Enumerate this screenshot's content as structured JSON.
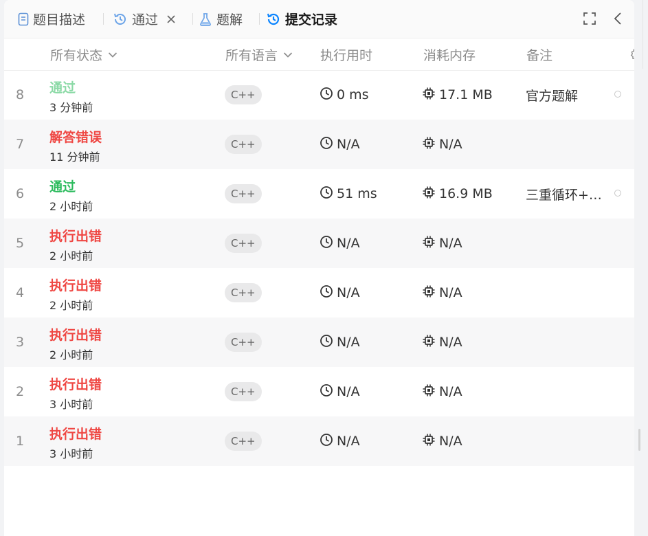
{
  "tabs": {
    "description": {
      "label": "题目描述",
      "icon": "document-icon"
    },
    "result": {
      "label": "通过",
      "icon": "history-icon"
    },
    "solutions": {
      "label": "题解",
      "icon": "flask-icon"
    },
    "submissions": {
      "label": "提交记录",
      "icon": "history-icon"
    }
  },
  "header": {
    "status": "所有状态",
    "language": "所有语言",
    "runtime": "执行用时",
    "memory": "消耗内存",
    "note": "备注"
  },
  "colors": {
    "accepted": "#2cbb5d",
    "error": "#ef4743",
    "active_tab_icon": "#0a84ff"
  },
  "submissions": [
    {
      "index": "8",
      "status": "通过",
      "time": "3 分钟前",
      "lang": "C++",
      "runtime": "0 ms",
      "memory": "17.1 MB",
      "note": "官方题解"
    },
    {
      "index": "7",
      "status": "解答错误",
      "time": "11 分钟前",
      "lang": "C++",
      "runtime": "N/A",
      "memory": "N/A",
      "note": ""
    },
    {
      "index": "6",
      "status": "通过",
      "time": "2 小时前",
      "lang": "C++",
      "runtime": "51 ms",
      "memory": "16.9 MB",
      "note": "三重循环+…"
    },
    {
      "index": "5",
      "status": "执行出错",
      "time": "2 小时前",
      "lang": "C++",
      "runtime": "N/A",
      "memory": "N/A",
      "note": ""
    },
    {
      "index": "4",
      "status": "执行出错",
      "time": "2 小时前",
      "lang": "C++",
      "runtime": "N/A",
      "memory": "N/A",
      "note": ""
    },
    {
      "index": "3",
      "status": "执行出错",
      "time": "2 小时前",
      "lang": "C++",
      "runtime": "N/A",
      "memory": "N/A",
      "note": ""
    },
    {
      "index": "2",
      "status": "执行出错",
      "time": "3 小时前",
      "lang": "C++",
      "runtime": "N/A",
      "memory": "N/A",
      "note": ""
    },
    {
      "index": "1",
      "status": "执行出错",
      "time": "3 小时前",
      "lang": "C++",
      "runtime": "N/A",
      "memory": "N/A",
      "note": ""
    }
  ]
}
